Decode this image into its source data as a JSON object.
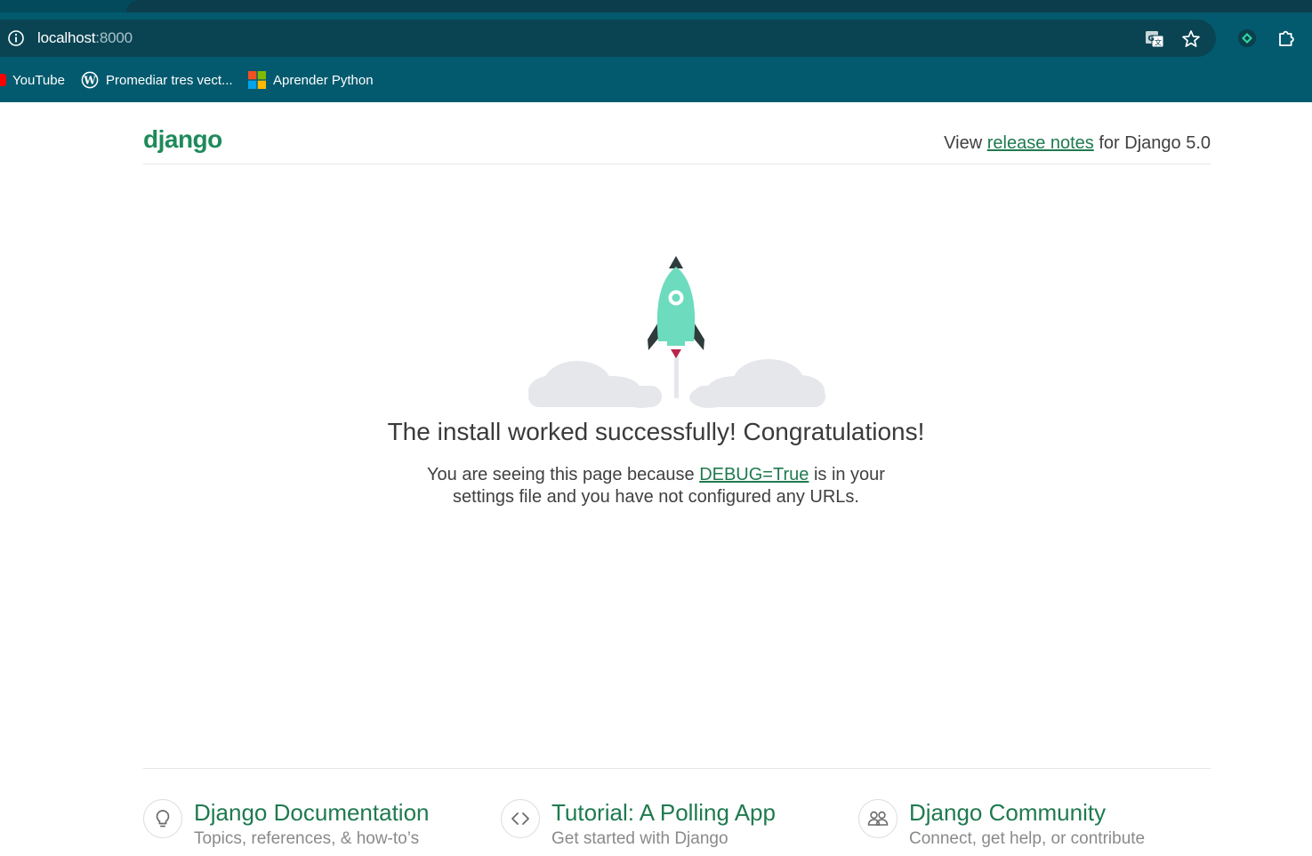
{
  "browser": {
    "url_host": "localhost",
    "url_port": ":8000",
    "bookmarks": [
      {
        "label": "YouTube",
        "icon": "youtube-icon"
      },
      {
        "label": "Promediar tres vect...",
        "icon": "wordpress-icon"
      },
      {
        "label": "Aprender Python",
        "icon": "microsoft-icon"
      }
    ],
    "colors": {
      "toolbar": "#035a6e",
      "omnibox": "#0a4453"
    }
  },
  "header": {
    "logo": "django",
    "release_prefix": "View",
    "release_link": "release notes",
    "release_suffix": "for Django 5.0"
  },
  "main": {
    "title": "The install worked successfully! Congratulations!",
    "body_prefix": "You are seeing this page because",
    "body_link": "DEBUG=True",
    "body_suffix": "is in your",
    "body_line2": "settings file and you have not configured any URLs."
  },
  "footer": {
    "cards": [
      {
        "title": "Django Documentation",
        "subtitle": "Topics, references, & how-to’s",
        "icon": "lightbulb-icon"
      },
      {
        "title": "Tutorial: A Polling App",
        "subtitle": "Get started with Django",
        "icon": "code-icon"
      },
      {
        "title": "Django Community",
        "subtitle": "Connect, get help, or contribute",
        "icon": "people-icon"
      }
    ]
  },
  "colors": {
    "accent": "#1f7a4f",
    "rocket": "#6ddbbe",
    "cloud": "#e5e7eb"
  }
}
